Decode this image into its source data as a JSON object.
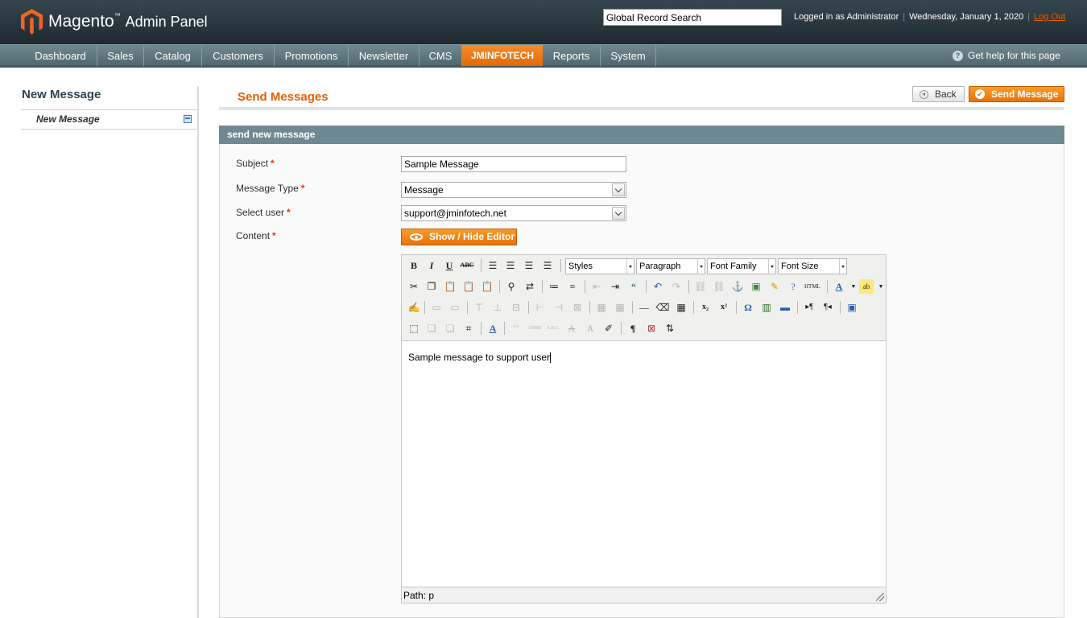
{
  "header": {
    "logo_text": "Magento",
    "logo_sub": "Admin Panel",
    "search_value": "Global Record Search",
    "logged_in": "Logged in as Administrator",
    "date": "Wednesday, January 1, 2020",
    "logout": "Log Out"
  },
  "nav": {
    "items": [
      "Dashboard",
      "Sales",
      "Catalog",
      "Customers",
      "Promotions",
      "Newsletter",
      "CMS",
      "JMINFOTECH",
      "Reports",
      "System"
    ],
    "help": "Get help for this page"
  },
  "sidebar": {
    "title": "New Message",
    "item": "New Message"
  },
  "main": {
    "title": "Send Messages",
    "back_button": "Back",
    "send_button": "Send Message",
    "fieldset_title": "send new message"
  },
  "form": {
    "subject_label": "Subject",
    "subject_value": "Sample Message",
    "type_label": "Message Type",
    "type_value": "Message",
    "user_label": "Select user",
    "user_value": "support@jminfotech.net",
    "content_label": "Content",
    "editor_button": "Show / Hide Editor"
  },
  "editor": {
    "styles": "Styles",
    "paragraph": "Paragraph",
    "font_family": "Font Family",
    "font_size": "Font Size",
    "content": "Sample message to support user",
    "path": "Path: p"
  },
  "colors": {
    "accent": "#eb5e00",
    "nav_bg": "#6f8992",
    "header_bg": "#1e2a30"
  }
}
